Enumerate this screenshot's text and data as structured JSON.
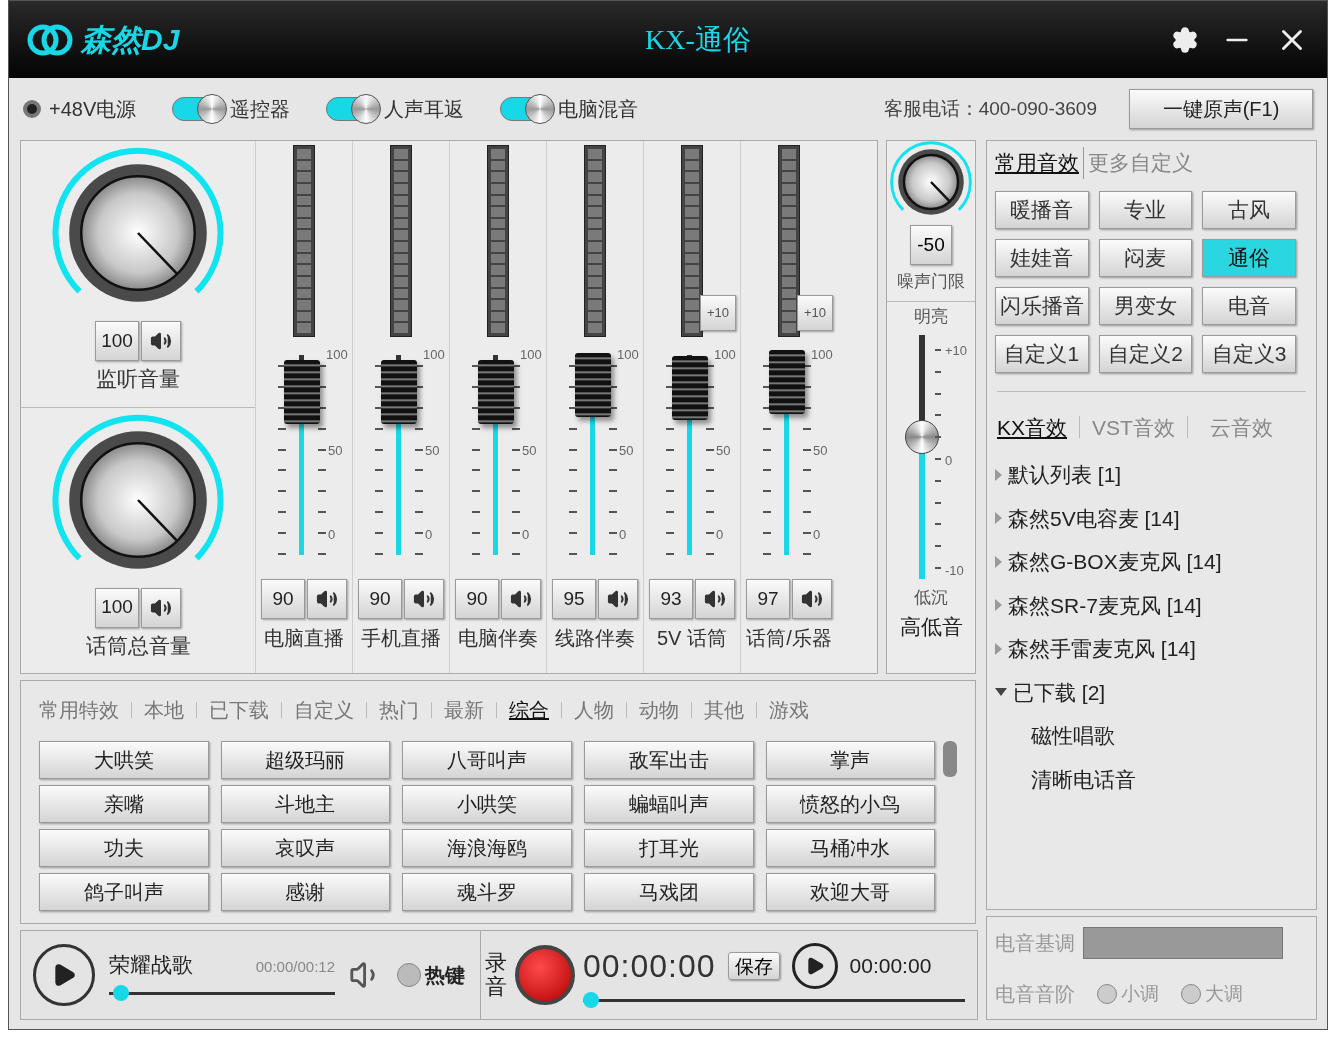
{
  "title_bar": {
    "logo": "森然DJ",
    "title": "KX-通俗"
  },
  "toolbar": {
    "phantom_power": {
      "label": "+48V电源",
      "on": false
    },
    "toggles": [
      {
        "label": "遥控器",
        "on": true
      },
      {
        "label": "人声耳返",
        "on": true
      },
      {
        "label": "电脑混音",
        "on": true
      }
    ],
    "hotline": "客服电话：400-090-3609",
    "reset_button": "一键原声(F1)"
  },
  "master": [
    {
      "value": "100",
      "label": "监听音量"
    },
    {
      "value": "100",
      "label": "话筒总音量"
    }
  ],
  "channels": [
    {
      "value": "90",
      "label": "电脑直播",
      "level": 0.9,
      "scale": [
        "100",
        "50",
        "0"
      ]
    },
    {
      "value": "90",
      "label": "手机直播",
      "level": 0.9,
      "scale": [
        "100",
        "50",
        "0"
      ]
    },
    {
      "value": "90",
      "label": "电脑伴奏",
      "level": 0.9,
      "scale": [
        "100",
        "50",
        "0"
      ]
    },
    {
      "value": "95",
      "label": "线路伴奏",
      "level": 0.95,
      "scale": [
        "100",
        "50",
        "0"
      ]
    },
    {
      "value": "93",
      "label": "5V 话筒",
      "level": 0.93,
      "boost": "+10",
      "scale": [
        "100",
        "50",
        "0"
      ]
    },
    {
      "value": "97",
      "label": "话筒/乐器",
      "level": 0.97,
      "boost": "+10",
      "scale": [
        "100",
        "50",
        "0"
      ]
    }
  ],
  "tone": {
    "gate_value": "-50",
    "gate_label": "噪声门限",
    "top_label": "明亮",
    "bottom_label": "低沉",
    "scale": [
      "+10",
      "0",
      "-10"
    ],
    "level": 0.58,
    "label": "高低音"
  },
  "presets": {
    "tabs": [
      {
        "label": "常用音效",
        "selected": true
      },
      {
        "label": "更多自定义",
        "selected": false
      }
    ],
    "buttons": [
      {
        "label": "暖播音",
        "selected": false
      },
      {
        "label": "专业",
        "selected": false
      },
      {
        "label": "古风",
        "selected": false
      },
      {
        "label": "娃娃音",
        "selected": false
      },
      {
        "label": "闷麦",
        "selected": false
      },
      {
        "label": "通俗",
        "selected": true
      },
      {
        "label": "闪乐播音",
        "selected": false
      },
      {
        "label": "男变女",
        "selected": false
      },
      {
        "label": "电音",
        "selected": false
      },
      {
        "label": "自定义1",
        "selected": false
      },
      {
        "label": "自定义2",
        "selected": false
      },
      {
        "label": "自定义3",
        "selected": false
      }
    ]
  },
  "library": {
    "tabs": [
      {
        "label": "KX音效",
        "selected": true
      },
      {
        "label": "VST音效",
        "selected": false
      },
      {
        "label": "云音效",
        "selected": false
      }
    ],
    "tree": [
      {
        "label": "默认列表 [1]",
        "expanded": false
      },
      {
        "label": "森然5V电容麦 [14]",
        "expanded": false
      },
      {
        "label": "森然G-BOX麦克风 [14]",
        "expanded": false
      },
      {
        "label": "森然SR-7麦克风 [14]",
        "expanded": false
      },
      {
        "label": "森然手雷麦克风 [14]",
        "expanded": false
      },
      {
        "label": "已下载 [2]",
        "expanded": true,
        "children": [
          {
            "label": "磁性唱歌"
          },
          {
            "label": "清晰电话音"
          }
        ]
      }
    ]
  },
  "effects": {
    "tabs": [
      {
        "label": "常用特效",
        "selected": false
      },
      {
        "label": "本地",
        "selected": false
      },
      {
        "label": "已下载",
        "selected": false
      },
      {
        "label": "自定义",
        "selected": false
      },
      {
        "label": "热门",
        "selected": false
      },
      {
        "label": "最新",
        "selected": false
      },
      {
        "label": "综合",
        "selected": true
      },
      {
        "label": "人物",
        "selected": false
      },
      {
        "label": "动物",
        "selected": false
      },
      {
        "label": "其他",
        "selected": false
      },
      {
        "label": "游戏",
        "selected": false
      }
    ],
    "buttons": [
      "大哄笑",
      "超级玛丽",
      "八哥叫声",
      "敌军出击",
      "掌声",
      "亲嘴",
      "斗地主",
      "小哄笑",
      "蝙蝠叫声",
      "愤怒的小鸟",
      "功夫",
      "哀叹声",
      "海浪海鸥",
      "打耳光",
      "马桶冲水",
      "鸽子叫声",
      "感谢",
      "魂斗罗",
      "马戏团",
      "欢迎大哥"
    ]
  },
  "player": {
    "song": "荣耀战歌",
    "time": "00:00/00:12",
    "level": 0.02,
    "hotkey": {
      "label": "热键",
      "on": false
    }
  },
  "recorder": {
    "label": "录音",
    "timer": "00:00:00",
    "save": "保存",
    "playback_time": "00:00:00",
    "level": 0.0
  },
  "electro": {
    "key_label": "电音基调",
    "scale_label": "电音音阶",
    "options": [
      {
        "label": "小调",
        "selected": false
      },
      {
        "label": "大调",
        "selected": false
      }
    ]
  }
}
